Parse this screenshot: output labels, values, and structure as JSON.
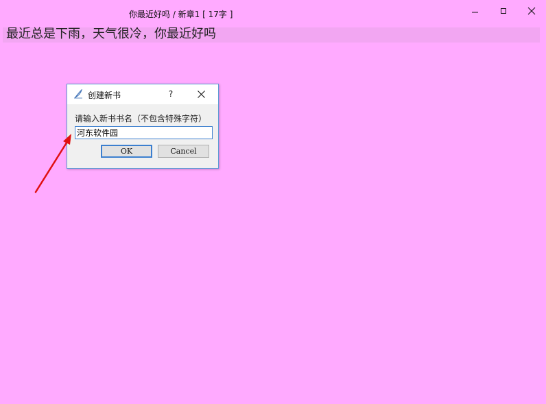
{
  "window": {
    "title": "你最近好吗 / 新章1 [ 17字 ]",
    "buttons": [
      "minimize-icon",
      "maximize-icon",
      "close-icon"
    ]
  },
  "editor": {
    "text": "最近总是下雨，天气很冷，你最近好吗"
  },
  "dialog": {
    "icon": "feather-pen-icon",
    "title": "创建新书",
    "help_label": "?",
    "prompt": "请输入新书书名（不包含特殊字符）",
    "input_value": "河东软件园",
    "ok_label": "OK",
    "cancel_label": "Cancel"
  },
  "colors": {
    "background": "#FFAAFF",
    "editor_line_highlight": "#F2A6F2",
    "dialog_border": "#5B9BD5",
    "annotation_arrow": "#E01010"
  }
}
